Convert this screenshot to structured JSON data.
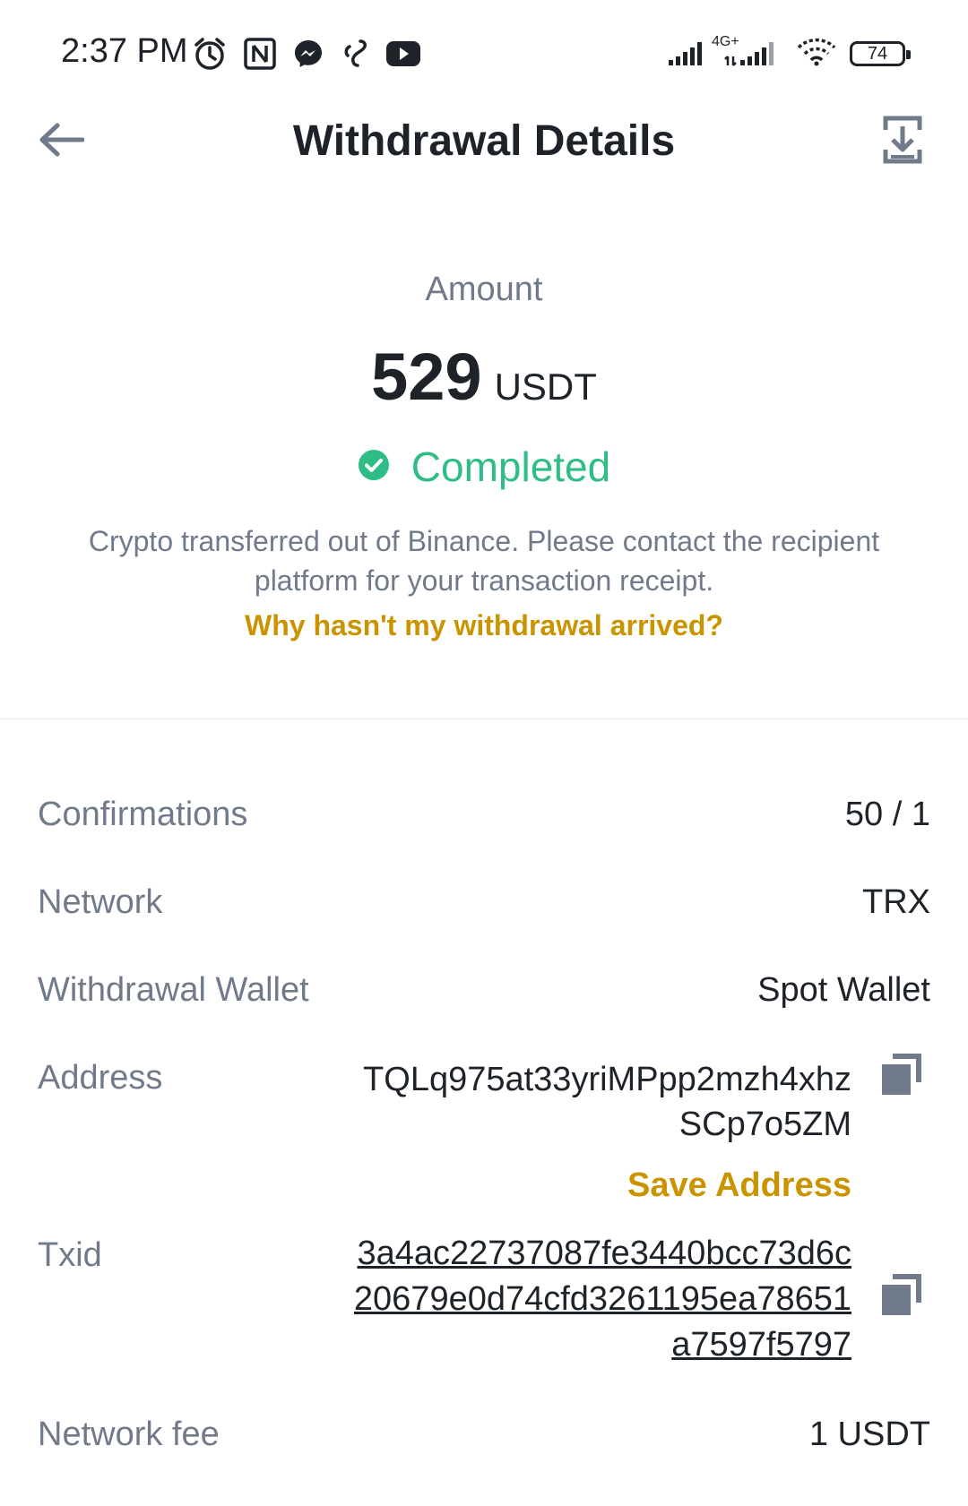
{
  "status_bar": {
    "time": "2:37 PM",
    "network_type": "4G+",
    "battery": "74",
    "left_icons": [
      "alarm-icon",
      "nfc-icon",
      "messenger-icon",
      "notification-icon",
      "youtube-icon"
    ],
    "right_icons": [
      "signal-icon",
      "signal-4g-icon",
      "wifi-icon",
      "battery-icon"
    ]
  },
  "header": {
    "title": "Withdrawal Details",
    "back_icon": "arrow-left-icon",
    "export_icon": "export-icon"
  },
  "summary": {
    "amount_label": "Amount",
    "amount_value": "529",
    "amount_unit": "USDT",
    "status": "Completed",
    "notice": "Crypto transferred out of Binance. Please contact the recipient platform for your transaction receipt.",
    "help_link": "Why hasn't my withdrawal arrived?"
  },
  "details": {
    "confirmations": {
      "label": "Confirmations",
      "value": "50 / 1"
    },
    "network": {
      "label": "Network",
      "value": "TRX"
    },
    "wallet": {
      "label": "Withdrawal Wallet",
      "value": "Spot Wallet"
    },
    "address": {
      "label": "Address",
      "value": "TQLq975at33yriMPpp2mzh4xhzSCp7o5ZM",
      "save_label": "Save Address"
    },
    "txid": {
      "label": "Txid",
      "value": "3a4ac22737087fe3440bcc73d6c20679e0d74cfd3261195ea78651a7597f5797"
    },
    "fee": {
      "label": "Network fee",
      "value": "1 USDT"
    }
  },
  "colors": {
    "success": "#2ebd85",
    "link": "#c99400",
    "text_primary": "#1e2329",
    "text_secondary": "#707a8a"
  }
}
